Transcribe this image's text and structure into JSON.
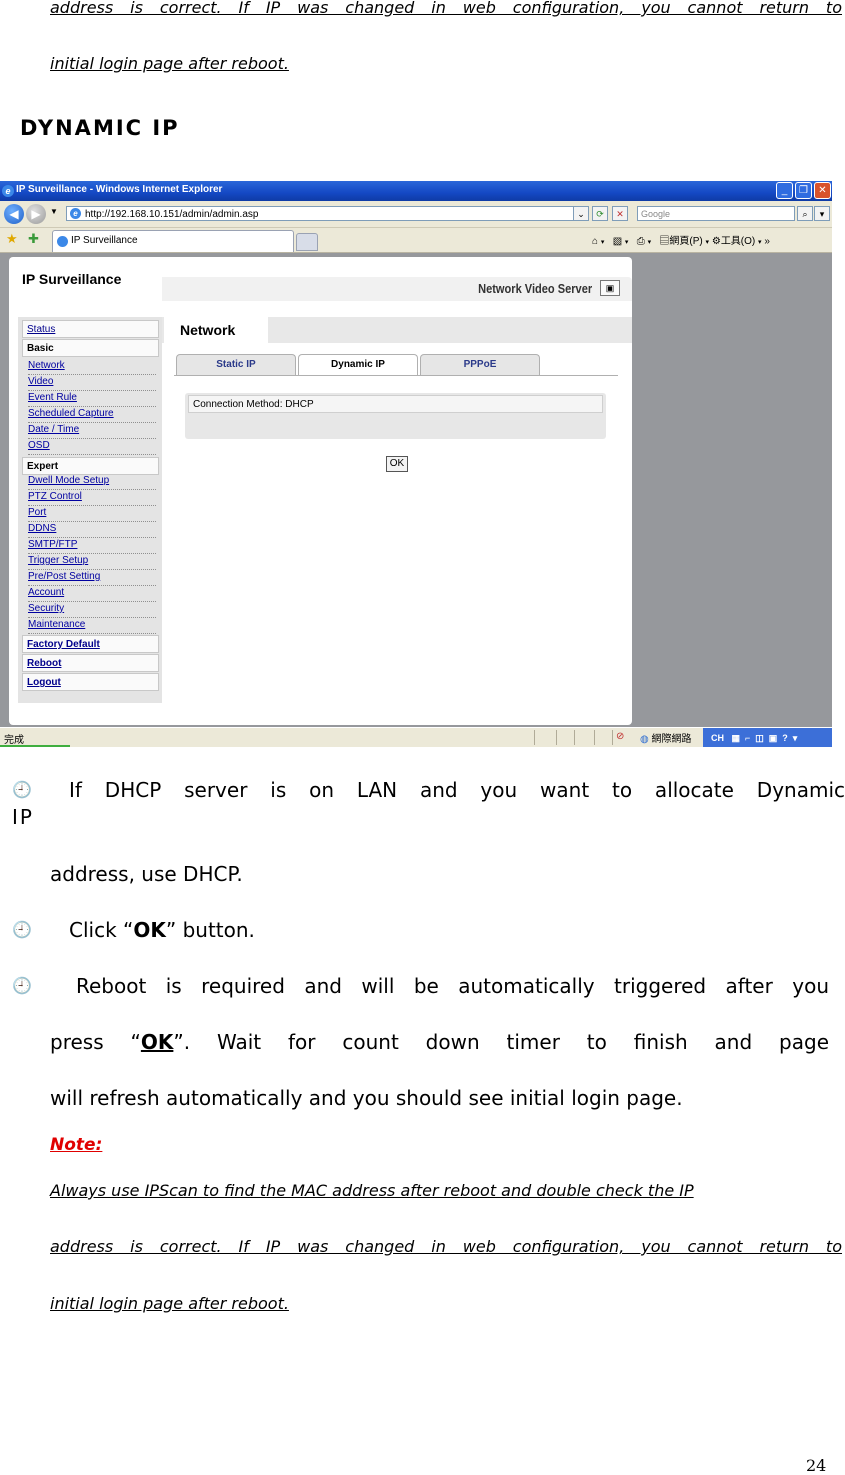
{
  "top_note": {
    "line1": "address is correct. If IP was changed in web configuration, you cannot return to",
    "line2": "initial login page after reboot."
  },
  "section_heading": "DYNAMIC IP",
  "browser": {
    "window_title": "IP Surveillance - Windows Internet Explorer",
    "url": "http://192.168.10.151/admin/admin.asp",
    "search_placeholder": "Google",
    "tab_label": "IP Surveillance",
    "toolbar_page_label": "網頁(P)",
    "toolbar_tools_label": "工具(O)",
    "toolbar_more": "»",
    "status_text": "完成",
    "status_zone": "網際網路",
    "ime_text": "CH"
  },
  "app": {
    "title": "IP Surveillance",
    "header_right": "Network Video Server",
    "nav": {
      "status": "Status",
      "basic": "Basic",
      "basic_items": [
        "Network",
        "Video",
        "Event Rule",
        "Scheduled Capture",
        "Date / Time",
        "OSD"
      ],
      "expert": "Expert",
      "expert_items": [
        "Dwell Mode Setup",
        "PTZ Control",
        "Port",
        "DDNS",
        "SMTP/FTP",
        "Trigger Setup",
        "Pre/Post Setting",
        "Account",
        "Security",
        "Maintenance"
      ],
      "factory_default": "Factory Default",
      "reboot": "Reboot",
      "logout": "Logout"
    },
    "section_tab": "Network",
    "subtabs": [
      "Static IP",
      "Dynamic IP",
      "PPPoE"
    ],
    "connection_method": "Connection Method: DHCP",
    "ok_button": "OK"
  },
  "instructions": {
    "bullet_glyph": "🕘",
    "b1_line1": "If  DHCP  server  is  on  LAN  and  you  want  to  allocate  Dynamic",
    "b1_line1b": "IP",
    "b1_line2": "address, use DHCP.",
    "b2_pre": "Click “",
    "b2_bold": "OK",
    "b2_post": "” button.",
    "b3_line1": "Reboot is required and will be automatically triggered after you",
    "b3_line2_pre": "press “",
    "b3_line2_bold": "OK",
    "b3_line2_post": "”.  Wait  for  count  down  timer  to  finish  and  page",
    "b3_line3": "will  refresh automatically and you should see initial login page."
  },
  "note": {
    "label": "Note:",
    "line1": "Always use IPScan to find the MAC address after reboot and double check the IP",
    "line2": "address is correct. If IP was changed in web configuration, you cannot return to",
    "line3": "initial login page after reboot."
  },
  "page_number": "24"
}
